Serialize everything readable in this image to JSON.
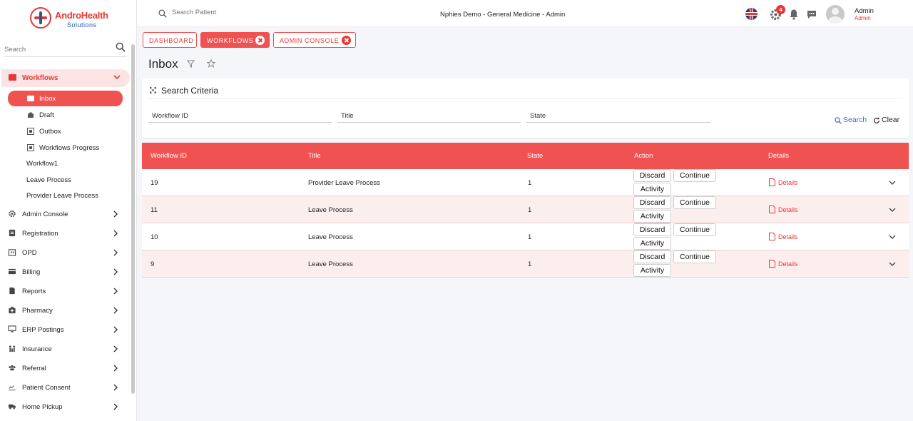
{
  "brand": {
    "name": "AndroHealth",
    "tagline": "Solutions"
  },
  "colors": {
    "accent": "#f05252",
    "accent_dark": "#e53935",
    "link": "#3a6fc9",
    "row_alt": "#fdeeee"
  },
  "sidebar": {
    "search_placeholder": "Search",
    "workflows": {
      "label": "Workflows",
      "icon": "envelope-icon",
      "subitems": [
        {
          "label": "Inbox",
          "icon": "inbox-icon",
          "active": true
        },
        {
          "label": "Draft",
          "icon": "draft-icon"
        },
        {
          "label": "Outbox",
          "icon": "outbox-icon"
        },
        {
          "label": "Workflows Progress",
          "icon": "progress-icon"
        }
      ],
      "extra_items": [
        "Workflow1",
        "Leave Process",
        "Provider Leave Process"
      ]
    },
    "items": [
      {
        "label": "Admin Console",
        "icon": "gear-icon"
      },
      {
        "label": "Registration",
        "icon": "registration-icon"
      },
      {
        "label": "OPD",
        "icon": "opd-icon"
      },
      {
        "label": "Billing",
        "icon": "billing-icon"
      },
      {
        "label": "Reports",
        "icon": "reports-icon"
      },
      {
        "label": "Pharmacy",
        "icon": "pharmacy-icon"
      },
      {
        "label": "ERP Postings",
        "icon": "erp-icon"
      },
      {
        "label": "Insurance",
        "icon": "insurance-icon"
      },
      {
        "label": "Referral",
        "icon": "referral-icon"
      },
      {
        "label": "Patient Consent",
        "icon": "consent-icon"
      },
      {
        "label": "Home Pickup",
        "icon": "truck-icon"
      }
    ]
  },
  "header": {
    "search_placeholder": "Search Patient",
    "context": "Nphies Demo - General Medicine - Admin",
    "notification_count": "4",
    "user_name": "Admin",
    "user_role": "Admin"
  },
  "tabs": [
    {
      "label": "DASHBOARD",
      "closable": false,
      "active": false
    },
    {
      "label": "WORKFLOWS",
      "closable": true,
      "active": true
    },
    {
      "label": "ADMIN CONSOLE",
      "closable": true,
      "active": false
    }
  ],
  "page": {
    "title": "Inbox"
  },
  "criteria": {
    "title": "Search Criteria",
    "fields": [
      "Workflow ID",
      "Title",
      "State"
    ],
    "search_label": "Search",
    "clear_label": "Clear"
  },
  "table": {
    "columns": [
      "Workflow ID",
      "Title",
      "State",
      "Action",
      "Details"
    ],
    "action_labels": {
      "discard": "Discard",
      "continue": "Continue",
      "activity": "Activity"
    },
    "details_label": "Details",
    "rows": [
      {
        "id": "19",
        "title": "Provider Leave Process",
        "state": "1"
      },
      {
        "id": "11",
        "title": "Leave Process",
        "state": "1"
      },
      {
        "id": "10",
        "title": "Leave Process",
        "state": "1"
      },
      {
        "id": "9",
        "title": "Leave Process",
        "state": "1"
      }
    ]
  }
}
